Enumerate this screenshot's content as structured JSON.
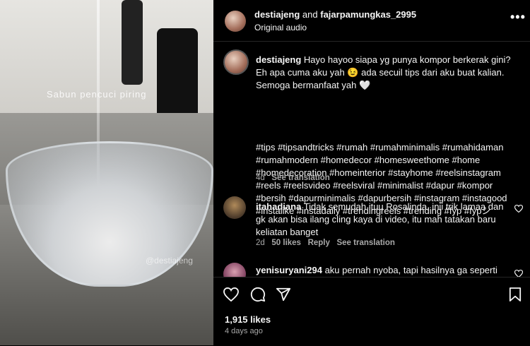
{
  "media": {
    "label": "Sabun pencuci piring",
    "watermark": "@destiajeng"
  },
  "header": {
    "author1": "destiajeng",
    "and": "and",
    "author2": "fajarpamungkas_2995",
    "audio": "Original audio",
    "more_icon": "more-horizontal-icon"
  },
  "caption": {
    "username": "destiajeng",
    "text": "Hayo hayoo siapa yg punya kompor berkerak gini? Eh apa cuma aku yah 😉 ada secuil tips dari aku buat kalian. Semoga bermanfaat yah 🤍",
    "hashtags": "#tips #tipsandtricks #rumah #rumahminimalis #rumahidaman #rumahmodern #homedecor #homesweethome #home #homedecoration #homeinterior #stayhome #reelsinstagram #reels #reelsvideo #reelsviral #minimalist #dapur #kompor #bersih #dapurminimalis #dapurbersih #instagram #instagood #instalike #instadaily #trendingreels #trending #fyp #fypシ",
    "time": "4d",
    "see_translation": "See translation"
  },
  "comments": [
    {
      "username": "itahadiana",
      "text": "Tidak semudah ituu Rosalinda, inii trik lamaa dan gk akan bisa ilang cling kaya di video, itu mah tatakan baru keliatan banget",
      "time": "2d",
      "likes": "50 likes",
      "reply": "Reply",
      "see_translation": "See translation"
    },
    {
      "username": "yenisuryani294",
      "text": "aku pernah nyoba, tapi hasilnya ga seperti itu,"
    }
  ],
  "actions": {
    "likes": "1,915 likes",
    "ago": "4 days ago"
  },
  "colors": {
    "background": "#000000",
    "text": "#f5f5f5",
    "muted": "#a8a8a8",
    "divider": "#262626"
  }
}
